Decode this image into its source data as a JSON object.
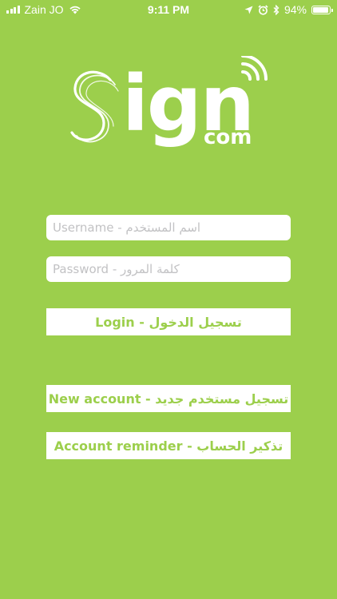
{
  "status_bar": {
    "carrier": "Zain JO",
    "time": "9:11 PM",
    "battery_percent_label": "94%",
    "battery_level": 0.94
  },
  "logo": {
    "letters": "ign",
    "suffix": "com"
  },
  "form": {
    "username_placeholder": "Username - اسم المستخدم",
    "password_placeholder": "Password - كلمة المرور",
    "login_label": "Login - تسجيل الدخول",
    "new_account_label": "New account - تسجيل مستخدم جديد",
    "reminder_label": "Account reminder - تذكير الحساب"
  },
  "colors": {
    "background": "#9ccf4c",
    "button_text": "#9ccf4c",
    "field_bg": "#ffffff",
    "placeholder": "#c2c2c4"
  }
}
